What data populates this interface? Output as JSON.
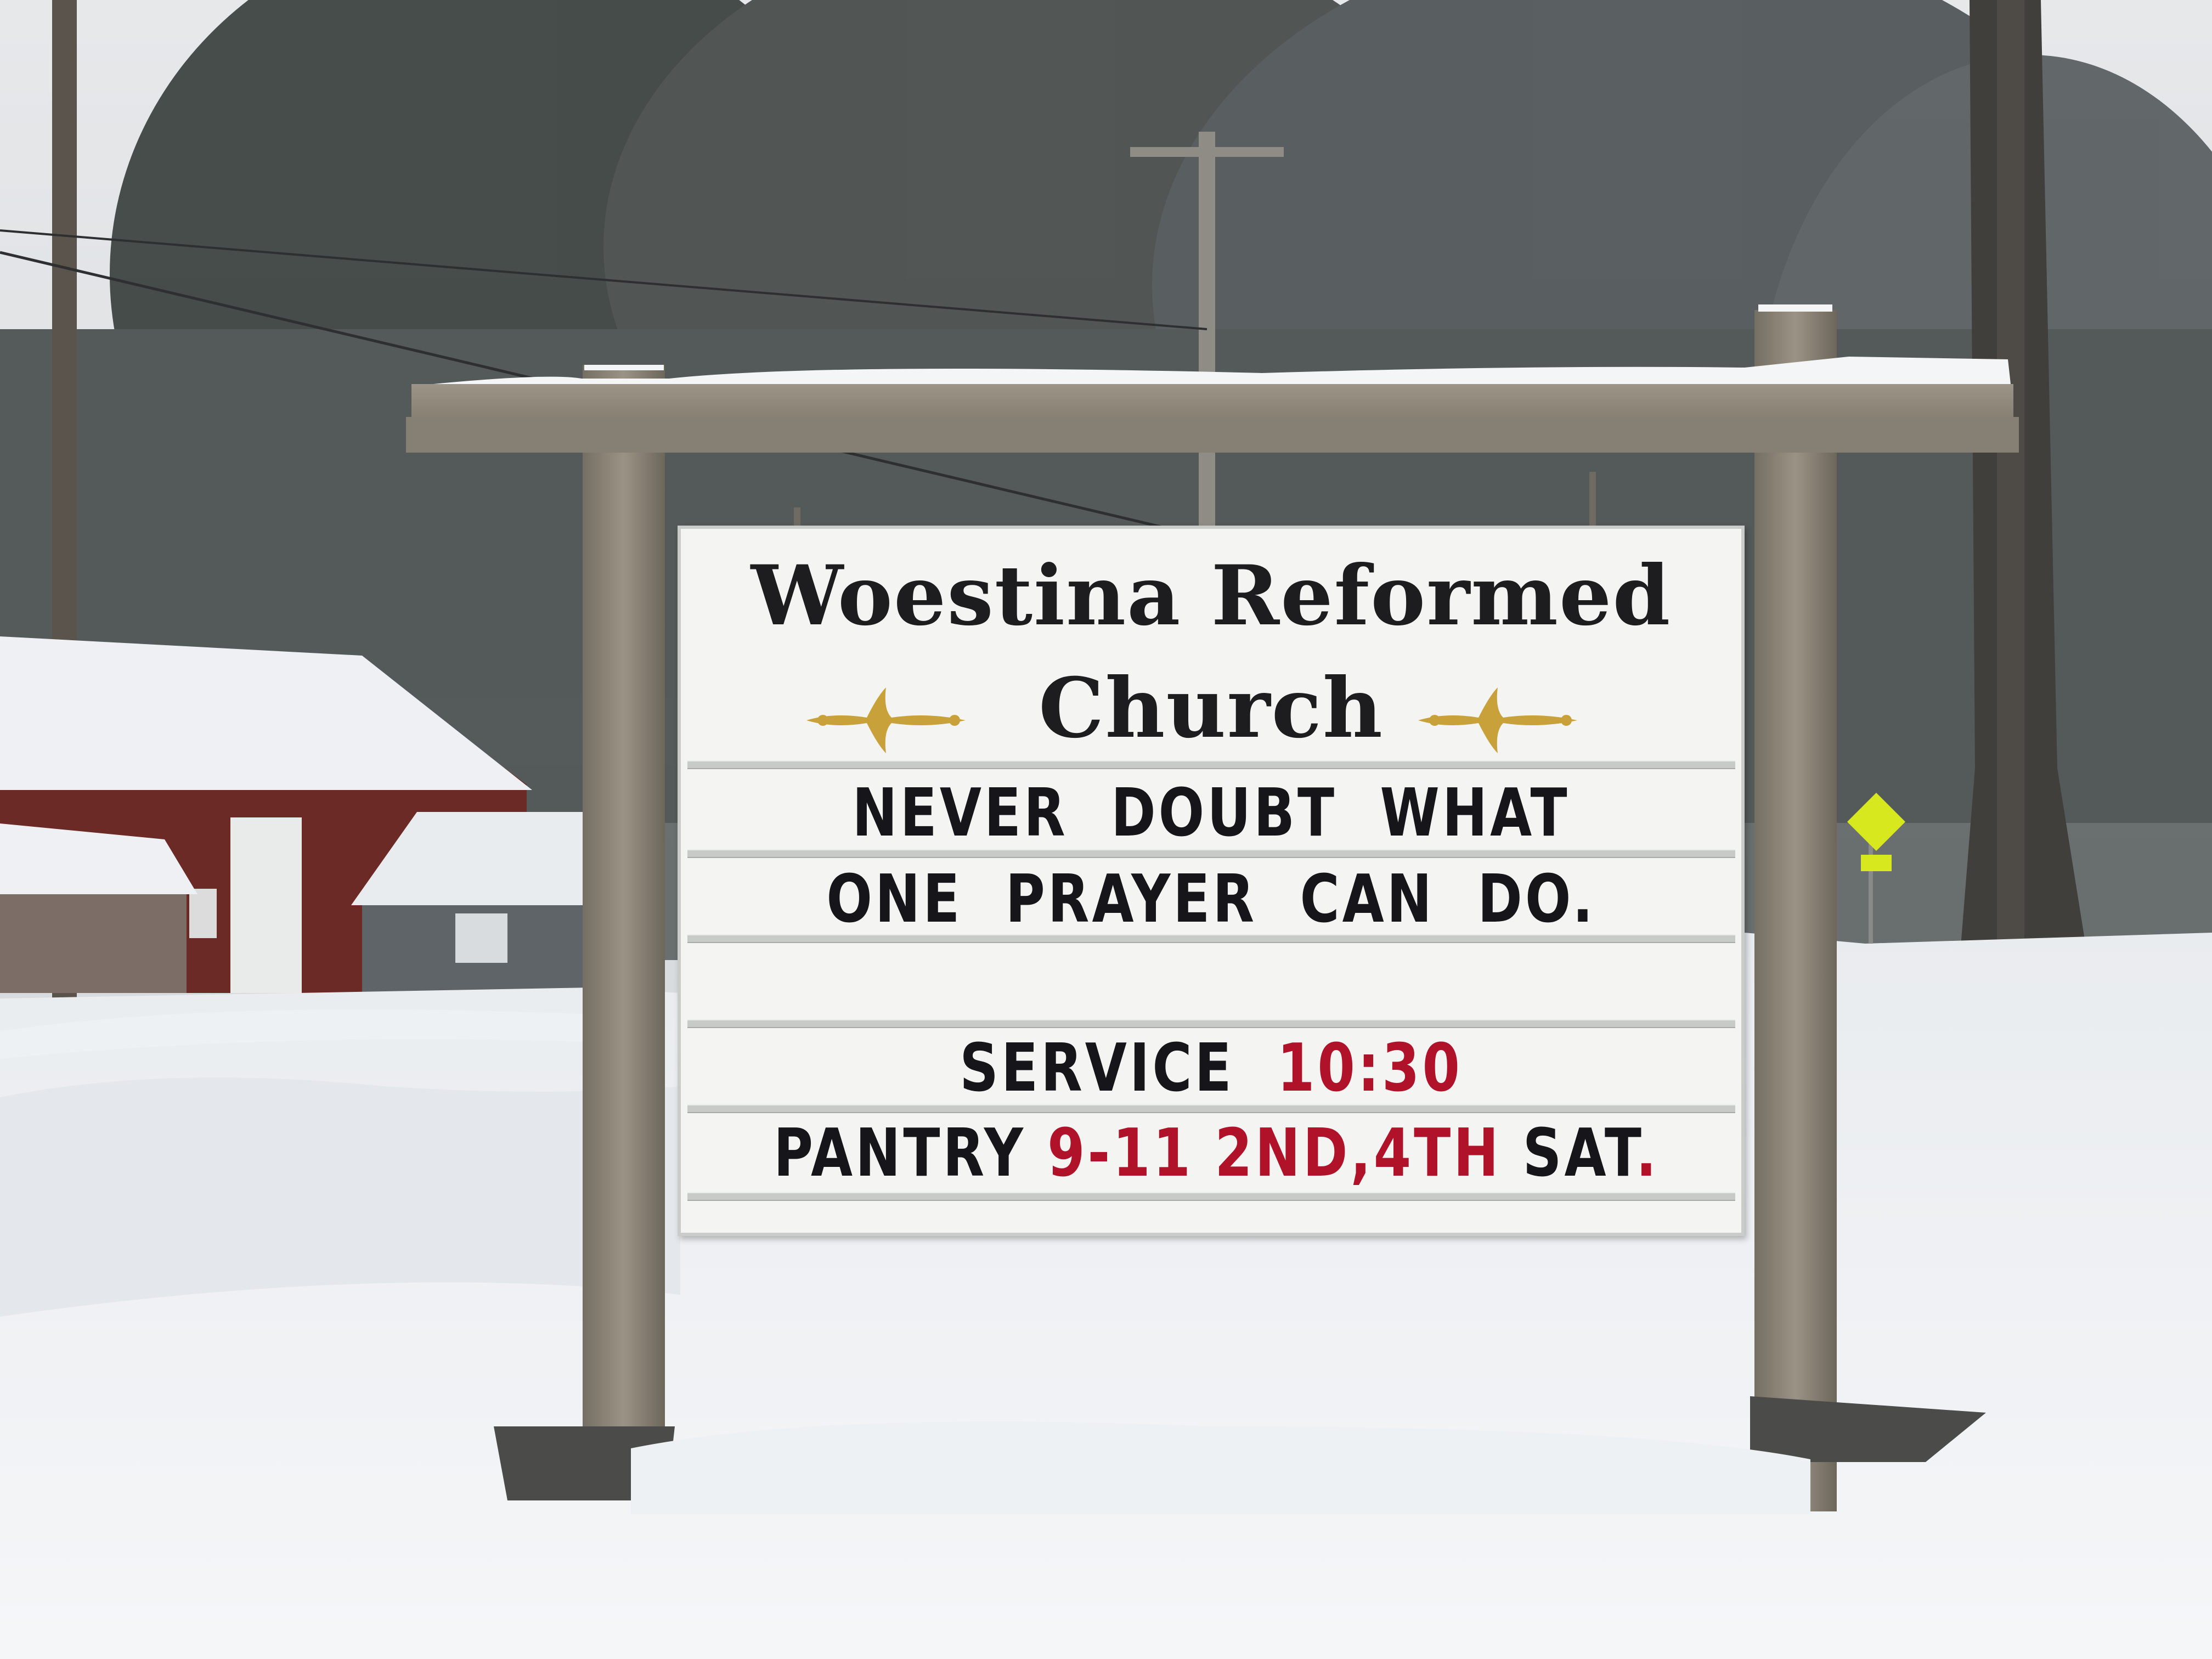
{
  "sign": {
    "title_line1": "Woestina Reformed",
    "title_line2": "Church",
    "message_line1": "NEVER  DOUBT  WHAT",
    "message_line2": "ONE  PRAYER  CAN  DO.",
    "service_label": "SERVICE",
    "service_time": "10:30",
    "pantry_label": "PANTRY",
    "pantry_hours": "9-11",
    "pantry_day1": "2ND",
    "pantry_comma": ",",
    "pantry_day2": "4TH",
    "pantry_sat": "SAT",
    "pantry_period": "."
  },
  "colors": {
    "sign_face": "#f4f5f3",
    "letter_black": "#15151a",
    "letter_red": "#b0122a",
    "flourish_gold": "#c9a13a",
    "wood": "#8d8678",
    "snow": "#f1f3f5",
    "sky": "#dfe3e6",
    "barn_red": "#6b2a25",
    "road_sign_yellow": "#d7e81f"
  },
  "icons": [
    "gold-flourish-icon",
    "bicycle-pedestrian-road-sign-icon"
  ]
}
